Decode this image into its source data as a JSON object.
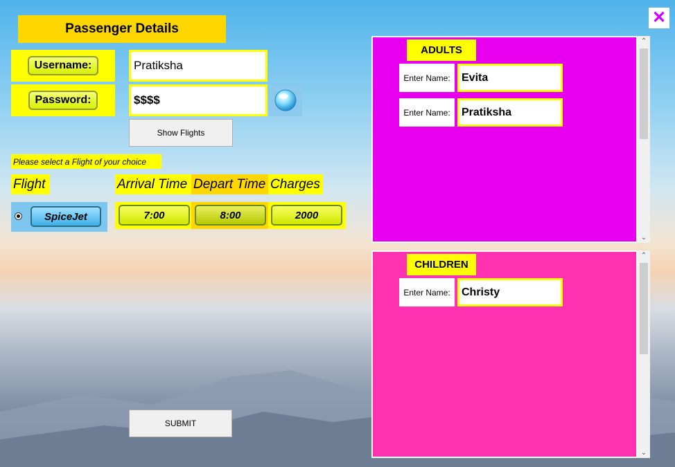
{
  "form": {
    "title": "Passenger Details",
    "username_label": "Username:",
    "username_value": "Pratiksha",
    "password_label": "Password:",
    "password_value": "$$$$",
    "show_flights_label": "Show Flights",
    "instruction": "Please select a Flight of your choice",
    "submit_label": "SUBMIT",
    "close_glyph": "✕"
  },
  "flight_table": {
    "headers": [
      "Flight",
      "Arrival Time",
      "Depart Time",
      "Charges"
    ],
    "row": {
      "flight": "SpiceJet",
      "arrival": "7:00",
      "depart": "8:00",
      "charges": "2000",
      "selected": true
    }
  },
  "adults": {
    "label": "ADULTS",
    "entries": [
      {
        "label": "Enter Name:",
        "value": "Evita"
      },
      {
        "label": "Enter Name:",
        "value": "Pratiksha"
      }
    ]
  },
  "children": {
    "label": "CHILDREN",
    "entries": [
      {
        "label": "Enter Name:",
        "value": "Christy"
      }
    ]
  },
  "colors": {
    "adults_panel": "#e800ee",
    "children_panel": "#ff33b1",
    "accent_yellow": "#ffff00",
    "title_gold": "#ffd700",
    "close_icon": "#cc00ff"
  },
  "icons": [
    "close-icon",
    "orb-icon",
    "radio-selected-icon",
    "chevron-up-icon",
    "chevron-down-icon"
  ]
}
